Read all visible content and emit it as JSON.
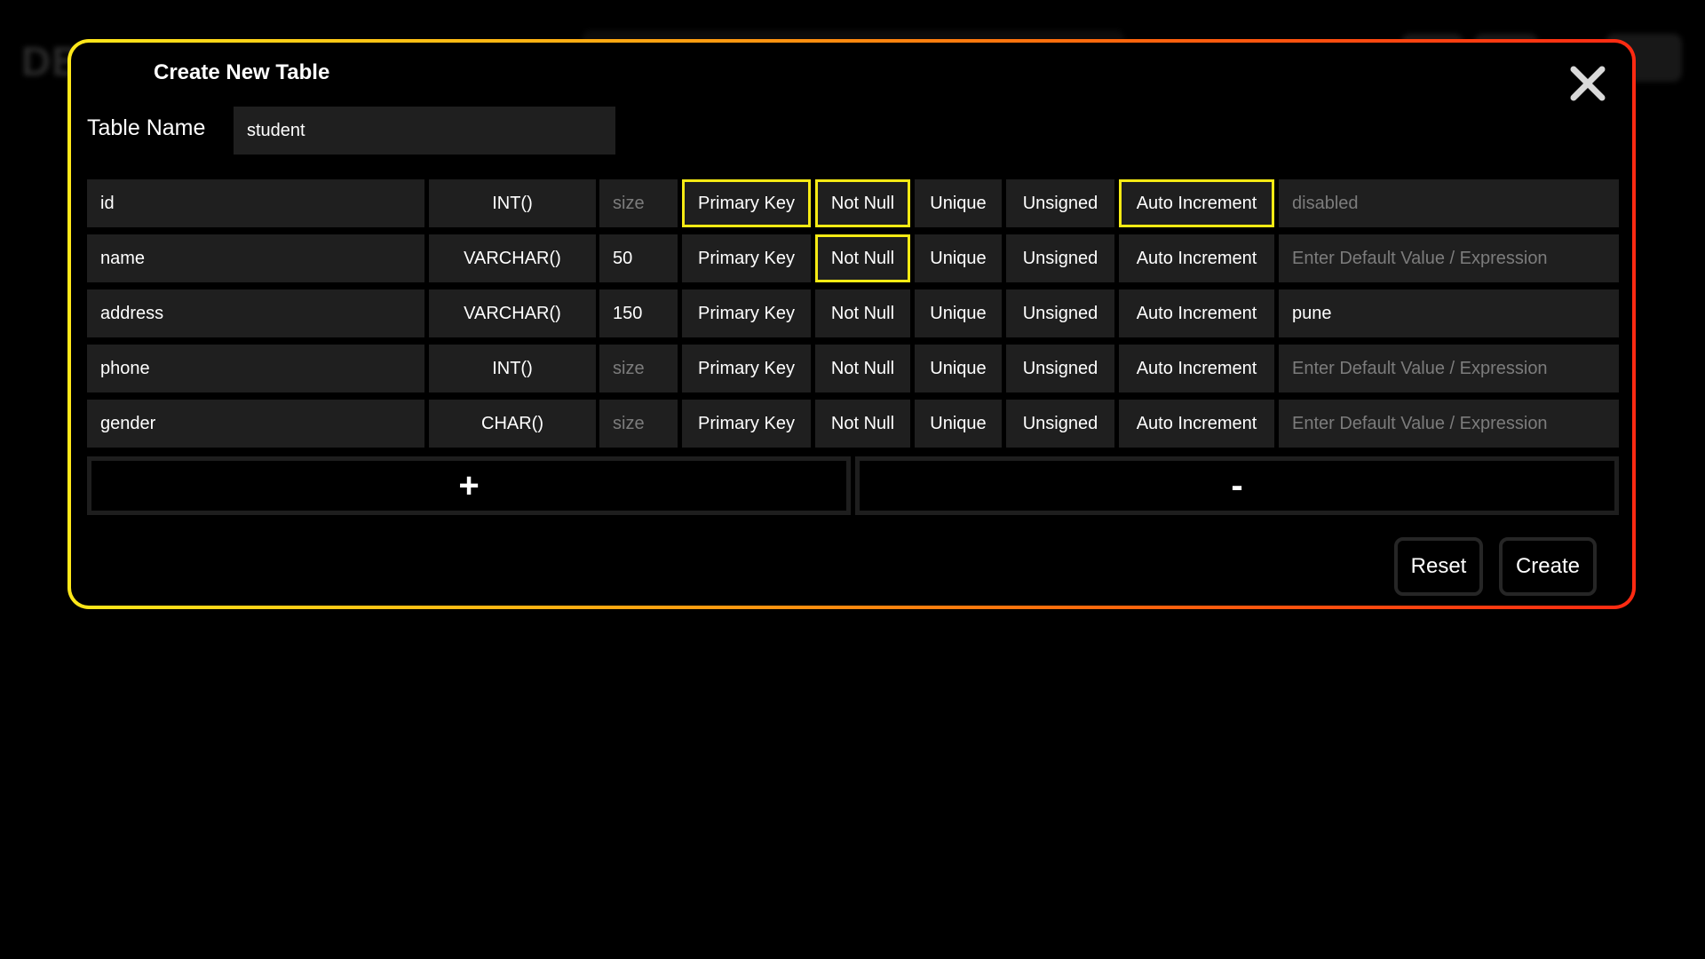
{
  "background": {
    "app_title_fragment": "DB"
  },
  "modal": {
    "title": "Create New Table",
    "close_icon": "close-x-icon",
    "table_name_label": "Table Name",
    "table_name_value": "student",
    "add_row_label": "+",
    "remove_row_label": "-",
    "reset_label": "Reset",
    "create_label": "Create"
  },
  "options": {
    "primary_key": "Primary Key",
    "not_null": "Not Null",
    "unique": "Unique",
    "unsigned": "Unsigned",
    "auto_increment": "Auto Increment"
  },
  "columns": [
    {
      "name": "id",
      "type": "INT()",
      "size": "size",
      "size_is_placeholder": true,
      "primary_key": true,
      "not_null": true,
      "unique": false,
      "unsigned": false,
      "auto_increment": true,
      "default": "disabled",
      "default_is_placeholder": true
    },
    {
      "name": "name",
      "type": "VARCHAR()",
      "size": "50",
      "size_is_placeholder": false,
      "primary_key": false,
      "not_null": true,
      "unique": false,
      "unsigned": false,
      "auto_increment": false,
      "default": "Enter Default Value / Expression",
      "default_is_placeholder": true
    },
    {
      "name": "address",
      "type": "VARCHAR()",
      "size": "150",
      "size_is_placeholder": false,
      "primary_key": false,
      "not_null": false,
      "unique": false,
      "unsigned": false,
      "auto_increment": false,
      "default": "pune",
      "default_is_placeholder": false
    },
    {
      "name": "phone",
      "type": "INT()",
      "size": "size",
      "size_is_placeholder": true,
      "primary_key": false,
      "not_null": false,
      "unique": false,
      "unsigned": false,
      "auto_increment": false,
      "default": "Enter Default Value / Expression",
      "default_is_placeholder": true
    },
    {
      "name": "gender",
      "type": "CHAR()",
      "size": "size",
      "size_is_placeholder": true,
      "primary_key": false,
      "not_null": false,
      "unique": false,
      "unsigned": false,
      "auto_increment": false,
      "default": "Enter Default Value / Expression",
      "default_is_placeholder": true
    }
  ],
  "colors": {
    "selected_outline": "#f5ea14",
    "cell_bg": "#1f1f1f",
    "placeholder_text": "#7c7c7c",
    "border_gradient_start": "#ffe81a",
    "border_gradient_end": "#ff2a12"
  }
}
